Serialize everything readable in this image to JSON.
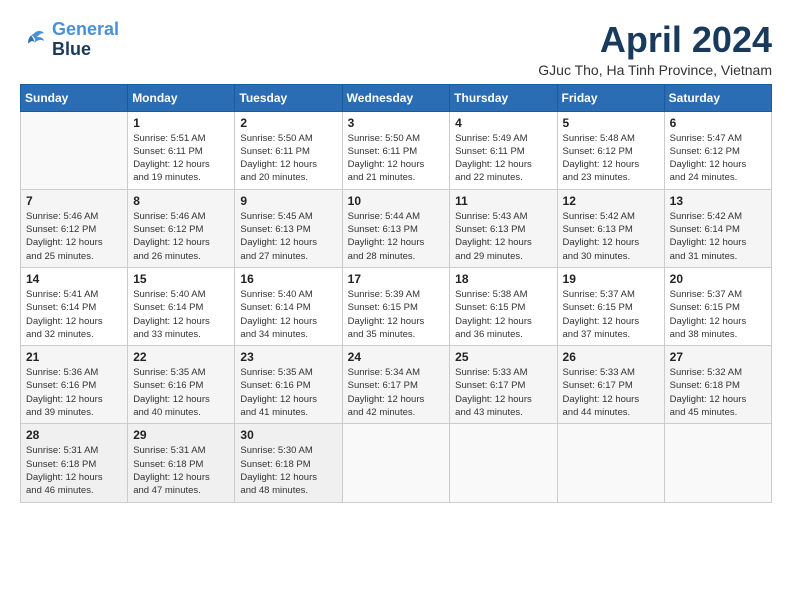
{
  "header": {
    "logo": {
      "line1": "General",
      "line2": "Blue"
    },
    "title": "April 2024",
    "location": "GJuc Tho, Ha Tinh Province, Vietnam"
  },
  "calendar": {
    "days_of_week": [
      "Sunday",
      "Monday",
      "Tuesday",
      "Wednesday",
      "Thursday",
      "Friday",
      "Saturday"
    ],
    "weeks": [
      [
        {
          "day": "",
          "info": ""
        },
        {
          "day": "1",
          "info": "Sunrise: 5:51 AM\nSunset: 6:11 PM\nDaylight: 12 hours\nand 19 minutes."
        },
        {
          "day": "2",
          "info": "Sunrise: 5:50 AM\nSunset: 6:11 PM\nDaylight: 12 hours\nand 20 minutes."
        },
        {
          "day": "3",
          "info": "Sunrise: 5:50 AM\nSunset: 6:11 PM\nDaylight: 12 hours\nand 21 minutes."
        },
        {
          "day": "4",
          "info": "Sunrise: 5:49 AM\nSunset: 6:11 PM\nDaylight: 12 hours\nand 22 minutes."
        },
        {
          "day": "5",
          "info": "Sunrise: 5:48 AM\nSunset: 6:12 PM\nDaylight: 12 hours\nand 23 minutes."
        },
        {
          "day": "6",
          "info": "Sunrise: 5:47 AM\nSunset: 6:12 PM\nDaylight: 12 hours\nand 24 minutes."
        }
      ],
      [
        {
          "day": "7",
          "info": "Sunrise: 5:46 AM\nSunset: 6:12 PM\nDaylight: 12 hours\nand 25 minutes."
        },
        {
          "day": "8",
          "info": "Sunrise: 5:46 AM\nSunset: 6:12 PM\nDaylight: 12 hours\nand 26 minutes."
        },
        {
          "day": "9",
          "info": "Sunrise: 5:45 AM\nSunset: 6:13 PM\nDaylight: 12 hours\nand 27 minutes."
        },
        {
          "day": "10",
          "info": "Sunrise: 5:44 AM\nSunset: 6:13 PM\nDaylight: 12 hours\nand 28 minutes."
        },
        {
          "day": "11",
          "info": "Sunrise: 5:43 AM\nSunset: 6:13 PM\nDaylight: 12 hours\nand 29 minutes."
        },
        {
          "day": "12",
          "info": "Sunrise: 5:42 AM\nSunset: 6:13 PM\nDaylight: 12 hours\nand 30 minutes."
        },
        {
          "day": "13",
          "info": "Sunrise: 5:42 AM\nSunset: 6:14 PM\nDaylight: 12 hours\nand 31 minutes."
        }
      ],
      [
        {
          "day": "14",
          "info": "Sunrise: 5:41 AM\nSunset: 6:14 PM\nDaylight: 12 hours\nand 32 minutes."
        },
        {
          "day": "15",
          "info": "Sunrise: 5:40 AM\nSunset: 6:14 PM\nDaylight: 12 hours\nand 33 minutes."
        },
        {
          "day": "16",
          "info": "Sunrise: 5:40 AM\nSunset: 6:14 PM\nDaylight: 12 hours\nand 34 minutes."
        },
        {
          "day": "17",
          "info": "Sunrise: 5:39 AM\nSunset: 6:15 PM\nDaylight: 12 hours\nand 35 minutes."
        },
        {
          "day": "18",
          "info": "Sunrise: 5:38 AM\nSunset: 6:15 PM\nDaylight: 12 hours\nand 36 minutes."
        },
        {
          "day": "19",
          "info": "Sunrise: 5:37 AM\nSunset: 6:15 PM\nDaylight: 12 hours\nand 37 minutes."
        },
        {
          "day": "20",
          "info": "Sunrise: 5:37 AM\nSunset: 6:15 PM\nDaylight: 12 hours\nand 38 minutes."
        }
      ],
      [
        {
          "day": "21",
          "info": "Sunrise: 5:36 AM\nSunset: 6:16 PM\nDaylight: 12 hours\nand 39 minutes."
        },
        {
          "day": "22",
          "info": "Sunrise: 5:35 AM\nSunset: 6:16 PM\nDaylight: 12 hours\nand 40 minutes."
        },
        {
          "day": "23",
          "info": "Sunrise: 5:35 AM\nSunset: 6:16 PM\nDaylight: 12 hours\nand 41 minutes."
        },
        {
          "day": "24",
          "info": "Sunrise: 5:34 AM\nSunset: 6:17 PM\nDaylight: 12 hours\nand 42 minutes."
        },
        {
          "day": "25",
          "info": "Sunrise: 5:33 AM\nSunset: 6:17 PM\nDaylight: 12 hours\nand 43 minutes."
        },
        {
          "day": "26",
          "info": "Sunrise: 5:33 AM\nSunset: 6:17 PM\nDaylight: 12 hours\nand 44 minutes."
        },
        {
          "day": "27",
          "info": "Sunrise: 5:32 AM\nSunset: 6:18 PM\nDaylight: 12 hours\nand 45 minutes."
        }
      ],
      [
        {
          "day": "28",
          "info": "Sunrise: 5:31 AM\nSunset: 6:18 PM\nDaylight: 12 hours\nand 46 minutes."
        },
        {
          "day": "29",
          "info": "Sunrise: 5:31 AM\nSunset: 6:18 PM\nDaylight: 12 hours\nand 47 minutes."
        },
        {
          "day": "30",
          "info": "Sunrise: 5:30 AM\nSunset: 6:18 PM\nDaylight: 12 hours\nand 48 minutes."
        },
        {
          "day": "",
          "info": ""
        },
        {
          "day": "",
          "info": ""
        },
        {
          "day": "",
          "info": ""
        },
        {
          "day": "",
          "info": ""
        }
      ]
    ]
  }
}
